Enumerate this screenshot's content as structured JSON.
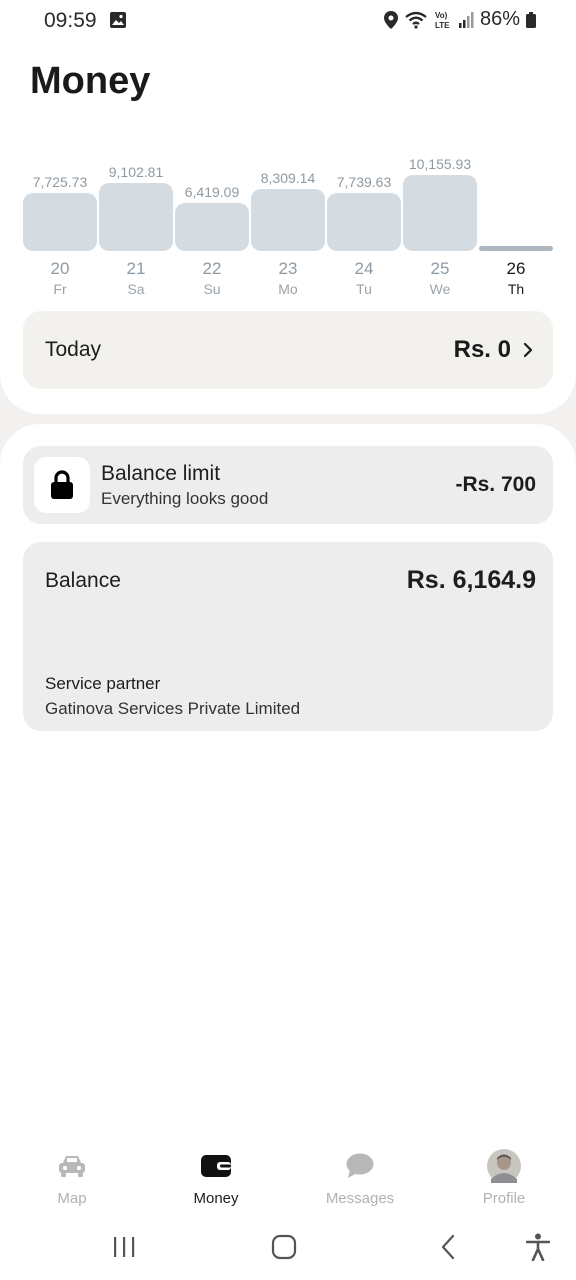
{
  "status": {
    "time": "09:59",
    "battery": "86%"
  },
  "header": {
    "title": "Money"
  },
  "chart_data": {
    "type": "bar",
    "categories": [
      "20",
      "21",
      "22",
      "23",
      "24",
      "25",
      "26"
    ],
    "day_names": [
      "Fr",
      "Sa",
      "Su",
      "Mo",
      "Tu",
      "We",
      "Th"
    ],
    "values": [
      7725.73,
      9102.81,
      6419.09,
      8309.14,
      7739.63,
      10155.93,
      0
    ],
    "value_labels": [
      "7,725.73",
      "9,102.81",
      "6,419.09",
      "8,309.14",
      "7,739.63",
      "10,155.93",
      ""
    ],
    "active_index": 6
  },
  "today": {
    "label": "Today",
    "amount": "Rs. 0"
  },
  "balance_limit": {
    "title": "Balance limit",
    "subtitle": "Everything looks good",
    "amount": "-Rs. 700"
  },
  "balance": {
    "label": "Balance",
    "amount": "Rs. 6,164.9",
    "partner_label": "Service partner",
    "partner_name": "Gatinova Services Private Limited"
  },
  "nav": {
    "items": [
      {
        "label": "Map",
        "icon": "car-icon",
        "active": false
      },
      {
        "label": "Money",
        "icon": "wallet-icon",
        "active": true
      },
      {
        "label": "Messages",
        "icon": "chat-bubble-icon",
        "active": false
      },
      {
        "label": "Profile",
        "icon": "avatar-icon",
        "active": false
      }
    ]
  },
  "colors": {
    "bar": "#d4dbe1",
    "bar_today": "#aeb7bf",
    "card": "#ededed"
  }
}
